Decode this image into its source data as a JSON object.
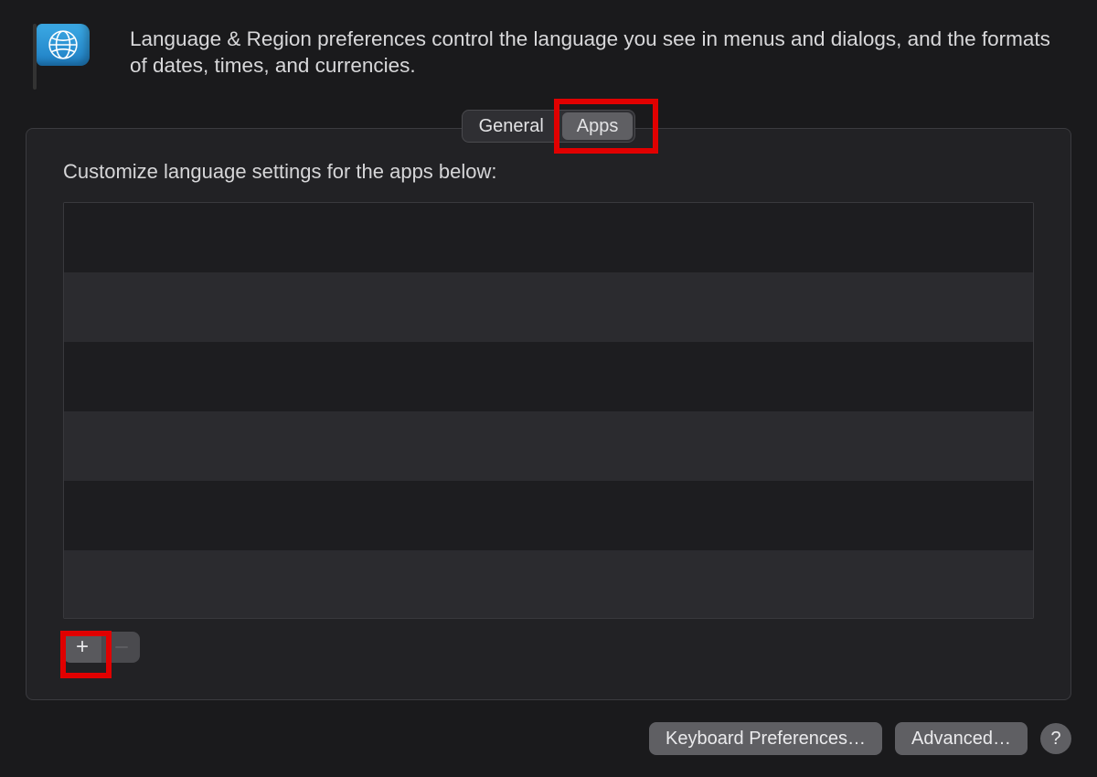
{
  "header": {
    "description": "Language & Region preferences control the language you see in menus and dialogs, and the formats of dates, times, and currencies."
  },
  "tabs": {
    "general_label": "General",
    "apps_label": "Apps",
    "active": "apps"
  },
  "panel": {
    "title": "Customize language settings for the apps below:",
    "rows": [
      "",
      "",
      "",
      "",
      "",
      ""
    ],
    "add_label": "+",
    "remove_label": "−"
  },
  "footer": {
    "keyboard_prefs_label": "Keyboard Preferences…",
    "advanced_label": "Advanced…",
    "help_label": "?"
  },
  "annotations": {
    "highlight_apps_tab": true,
    "highlight_add_button": true
  },
  "icons": {
    "flag": "globe-flag-icon"
  }
}
